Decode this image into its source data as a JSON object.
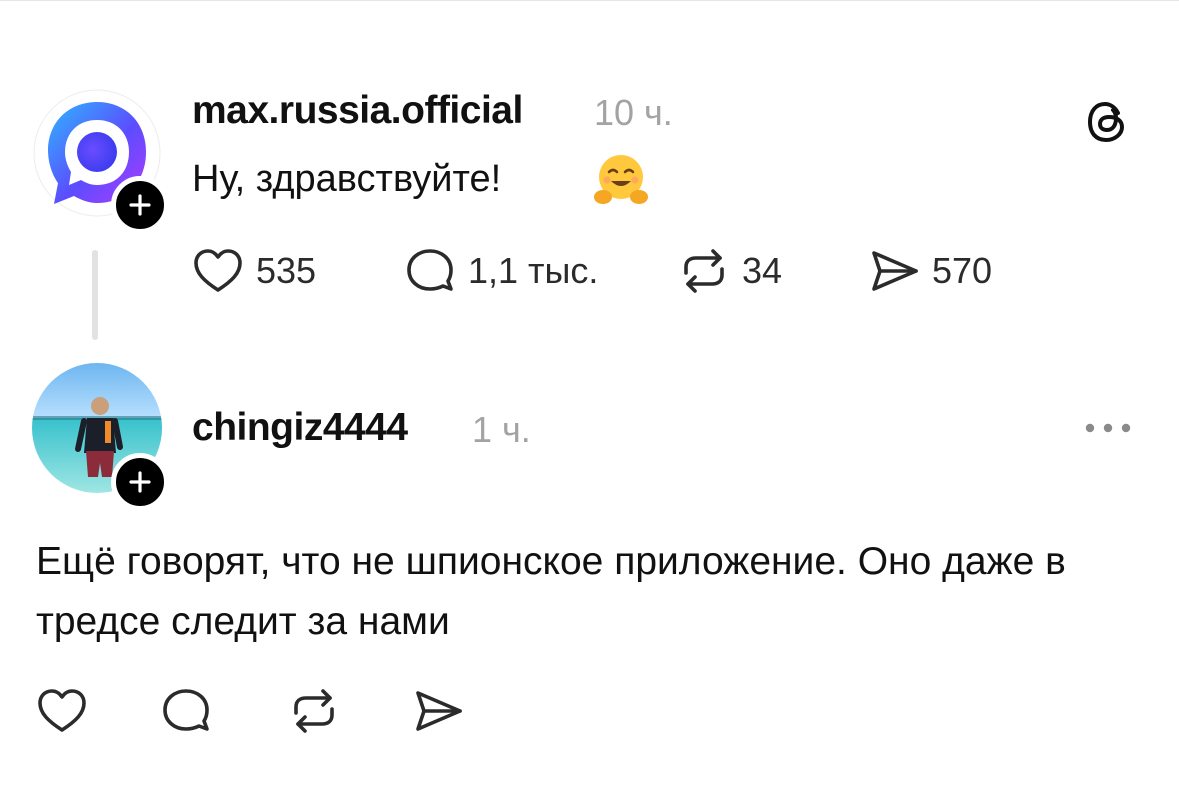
{
  "post1": {
    "username": "max.russia.official",
    "time": "10 ч.",
    "text": "Ну, здравствуйте!",
    "emoji": "hugging-face-emoji",
    "likes": "535",
    "replies": "1,1 тыс.",
    "reposts": "34",
    "shares": "570",
    "brand_gradient": [
      "#2fb7ff",
      "#5b4dff",
      "#b03aff"
    ]
  },
  "post2": {
    "username": "chingiz4444",
    "time": "1 ч.",
    "text": "Ещё говорят, что не шпионское приложение. Оно даже в тредсе следит за нами"
  },
  "icons": {
    "app_logo": "threads-logo-icon",
    "more": "more-dots-icon",
    "follow": "plus-icon",
    "like": "heart-icon",
    "reply": "comment-bubble-icon",
    "repost": "repost-icon",
    "share": "send-icon"
  }
}
